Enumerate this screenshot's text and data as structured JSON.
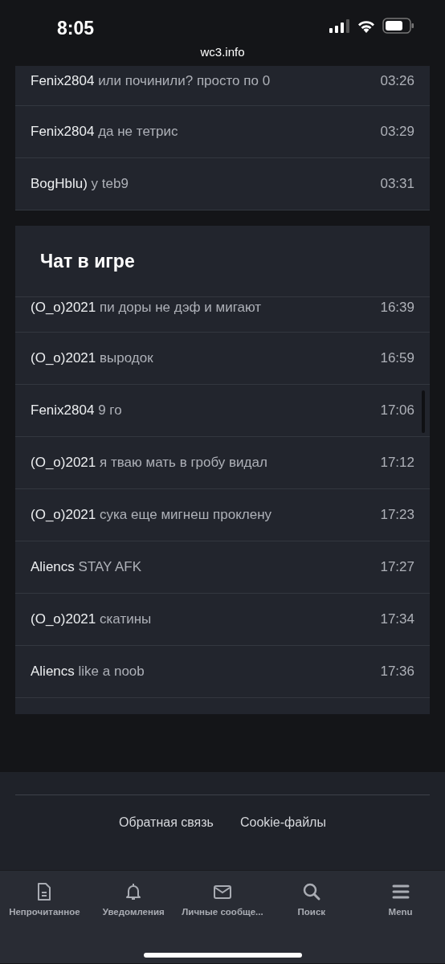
{
  "status_bar": {
    "time": "8:05"
  },
  "url": "wc3.info",
  "top_messages": [
    {
      "user": "Fenix2804",
      "text": "или починили? просто по 0",
      "time": "03:26"
    },
    {
      "user": "Fenix2804",
      "text": "да не тетрис",
      "time": "03:29"
    },
    {
      "user": "BogHblu)",
      "text": "у teb9",
      "time": "03:31"
    }
  ],
  "chat": {
    "title": "Чат в игре",
    "messages": [
      {
        "user": "(O_o)2021",
        "text": "пи доры не дэф и мигают",
        "time": "16:39"
      },
      {
        "user": "(O_o)2021",
        "text": "выродок",
        "time": "16:59"
      },
      {
        "user": "Fenix2804",
        "text": "9 го",
        "time": "17:06"
      },
      {
        "user": "(O_o)2021",
        "text": "я тваю мать в гробу видал",
        "time": "17:12"
      },
      {
        "user": "(O_o)2021",
        "text": "сука еще мигнеш проклену",
        "time": "17:23"
      },
      {
        "user": "Aliencs",
        "text": "STAY AFK",
        "time": "17:27"
      },
      {
        "user": "(O_o)2021",
        "text": "скатины",
        "time": "17:34"
      },
      {
        "user": "Aliencs",
        "text": "like a noob",
        "time": "17:36"
      }
    ]
  },
  "footer_links": [
    "Обратная связь",
    "Cookie-файлы"
  ],
  "tab_bar": [
    {
      "kind": "unread",
      "label": "Непрочитанное"
    },
    {
      "kind": "alerts",
      "label": "Уведомления"
    },
    {
      "kind": "messages",
      "label": "Личные сообще..."
    },
    {
      "kind": "search",
      "label": "Поиск"
    },
    {
      "kind": "menu",
      "label": "Menu"
    }
  ]
}
